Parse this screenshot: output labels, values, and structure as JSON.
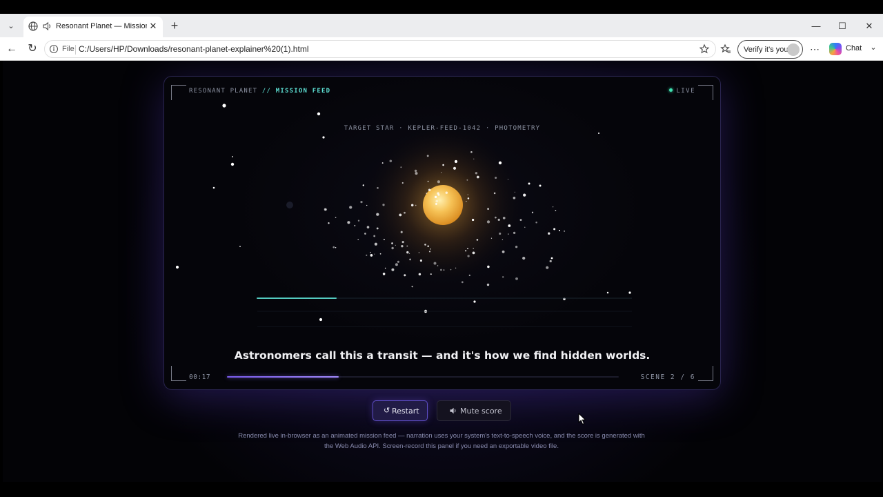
{
  "browser": {
    "tab_title": "Resonant Planet — Mission Fe",
    "address_scheme": "File",
    "url": "C:/Users/HP/Downloads/resonant-planet-explainer%20(1).html",
    "verify_label": "Verify it's you",
    "chat_label": "Chat"
  },
  "panel": {
    "feed_brand": "RESONANT PLANET",
    "feed_sep": "//",
    "feed_name": "MISSION FEED",
    "live_label": "LIVE",
    "target_line": "TARGET STAR · KEPLER-FEED-1042 · PHOTOMETRY",
    "caption": "Astronomers call this a transit — and it's how we find hidden worlds.",
    "timer": "00:17",
    "scene_counter": "SCENE 2 / 6",
    "progress_fraction": 0.285,
    "lightcurve_progress_fraction": 0.21
  },
  "controls": {
    "restart_icon": "↺",
    "restart_label": "Restart",
    "mute_icon": "🔊",
    "mute_label": "Mute score"
  },
  "footer_note": "Rendered live in-browser as an animated mission feed — narration uses your system's text-to-speech voice, and the score is generated with the Web Audio API. Screen-record this panel if you need an exportable video file.",
  "colors": {
    "accent_teal": "#5de0d4",
    "accent_violet": "#7b5cf0",
    "star_gold": "#f3b23a",
    "live_green": "#40e0b0"
  },
  "icons": {
    "tab_menu": "chevron-down-icon",
    "globe": "globe-icon",
    "speaker": "speaker-icon",
    "back": "back-arrow-icon",
    "reload": "reload-icon",
    "info": "info-icon",
    "star": "star-icon",
    "favorites": "favorites-icon",
    "more": "more-icon"
  }
}
